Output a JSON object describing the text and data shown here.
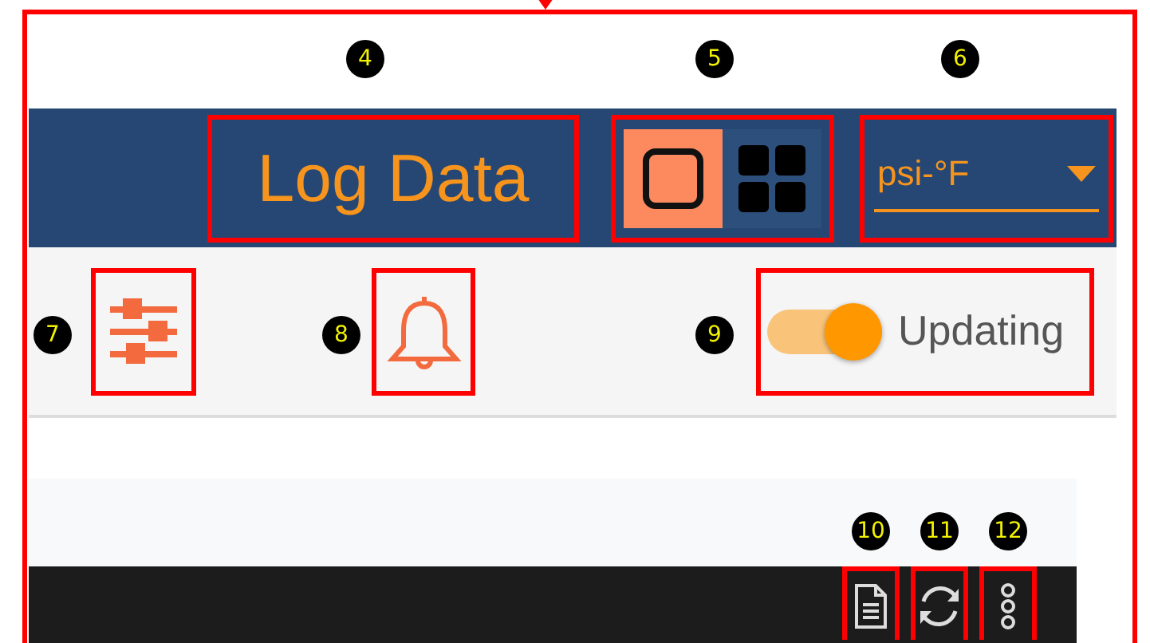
{
  "header": {
    "title": "Log Data",
    "title_callout": "4",
    "view_callout": "5",
    "view_options": [
      {
        "kind": "single",
        "selected": true
      },
      {
        "kind": "grid",
        "selected": false
      }
    ],
    "units": {
      "value": "psi-°F",
      "callout": "6"
    }
  },
  "toolbar": {
    "filters_callout": "7",
    "alarms_callout": "8",
    "updating": {
      "label": "Updating",
      "on": true,
      "callout": "9"
    }
  },
  "table_bar": {
    "actions": [
      {
        "kind": "export",
        "callout": "10"
      },
      {
        "kind": "refresh",
        "callout": "11"
      },
      {
        "kind": "more",
        "callout": "12"
      }
    ]
  }
}
